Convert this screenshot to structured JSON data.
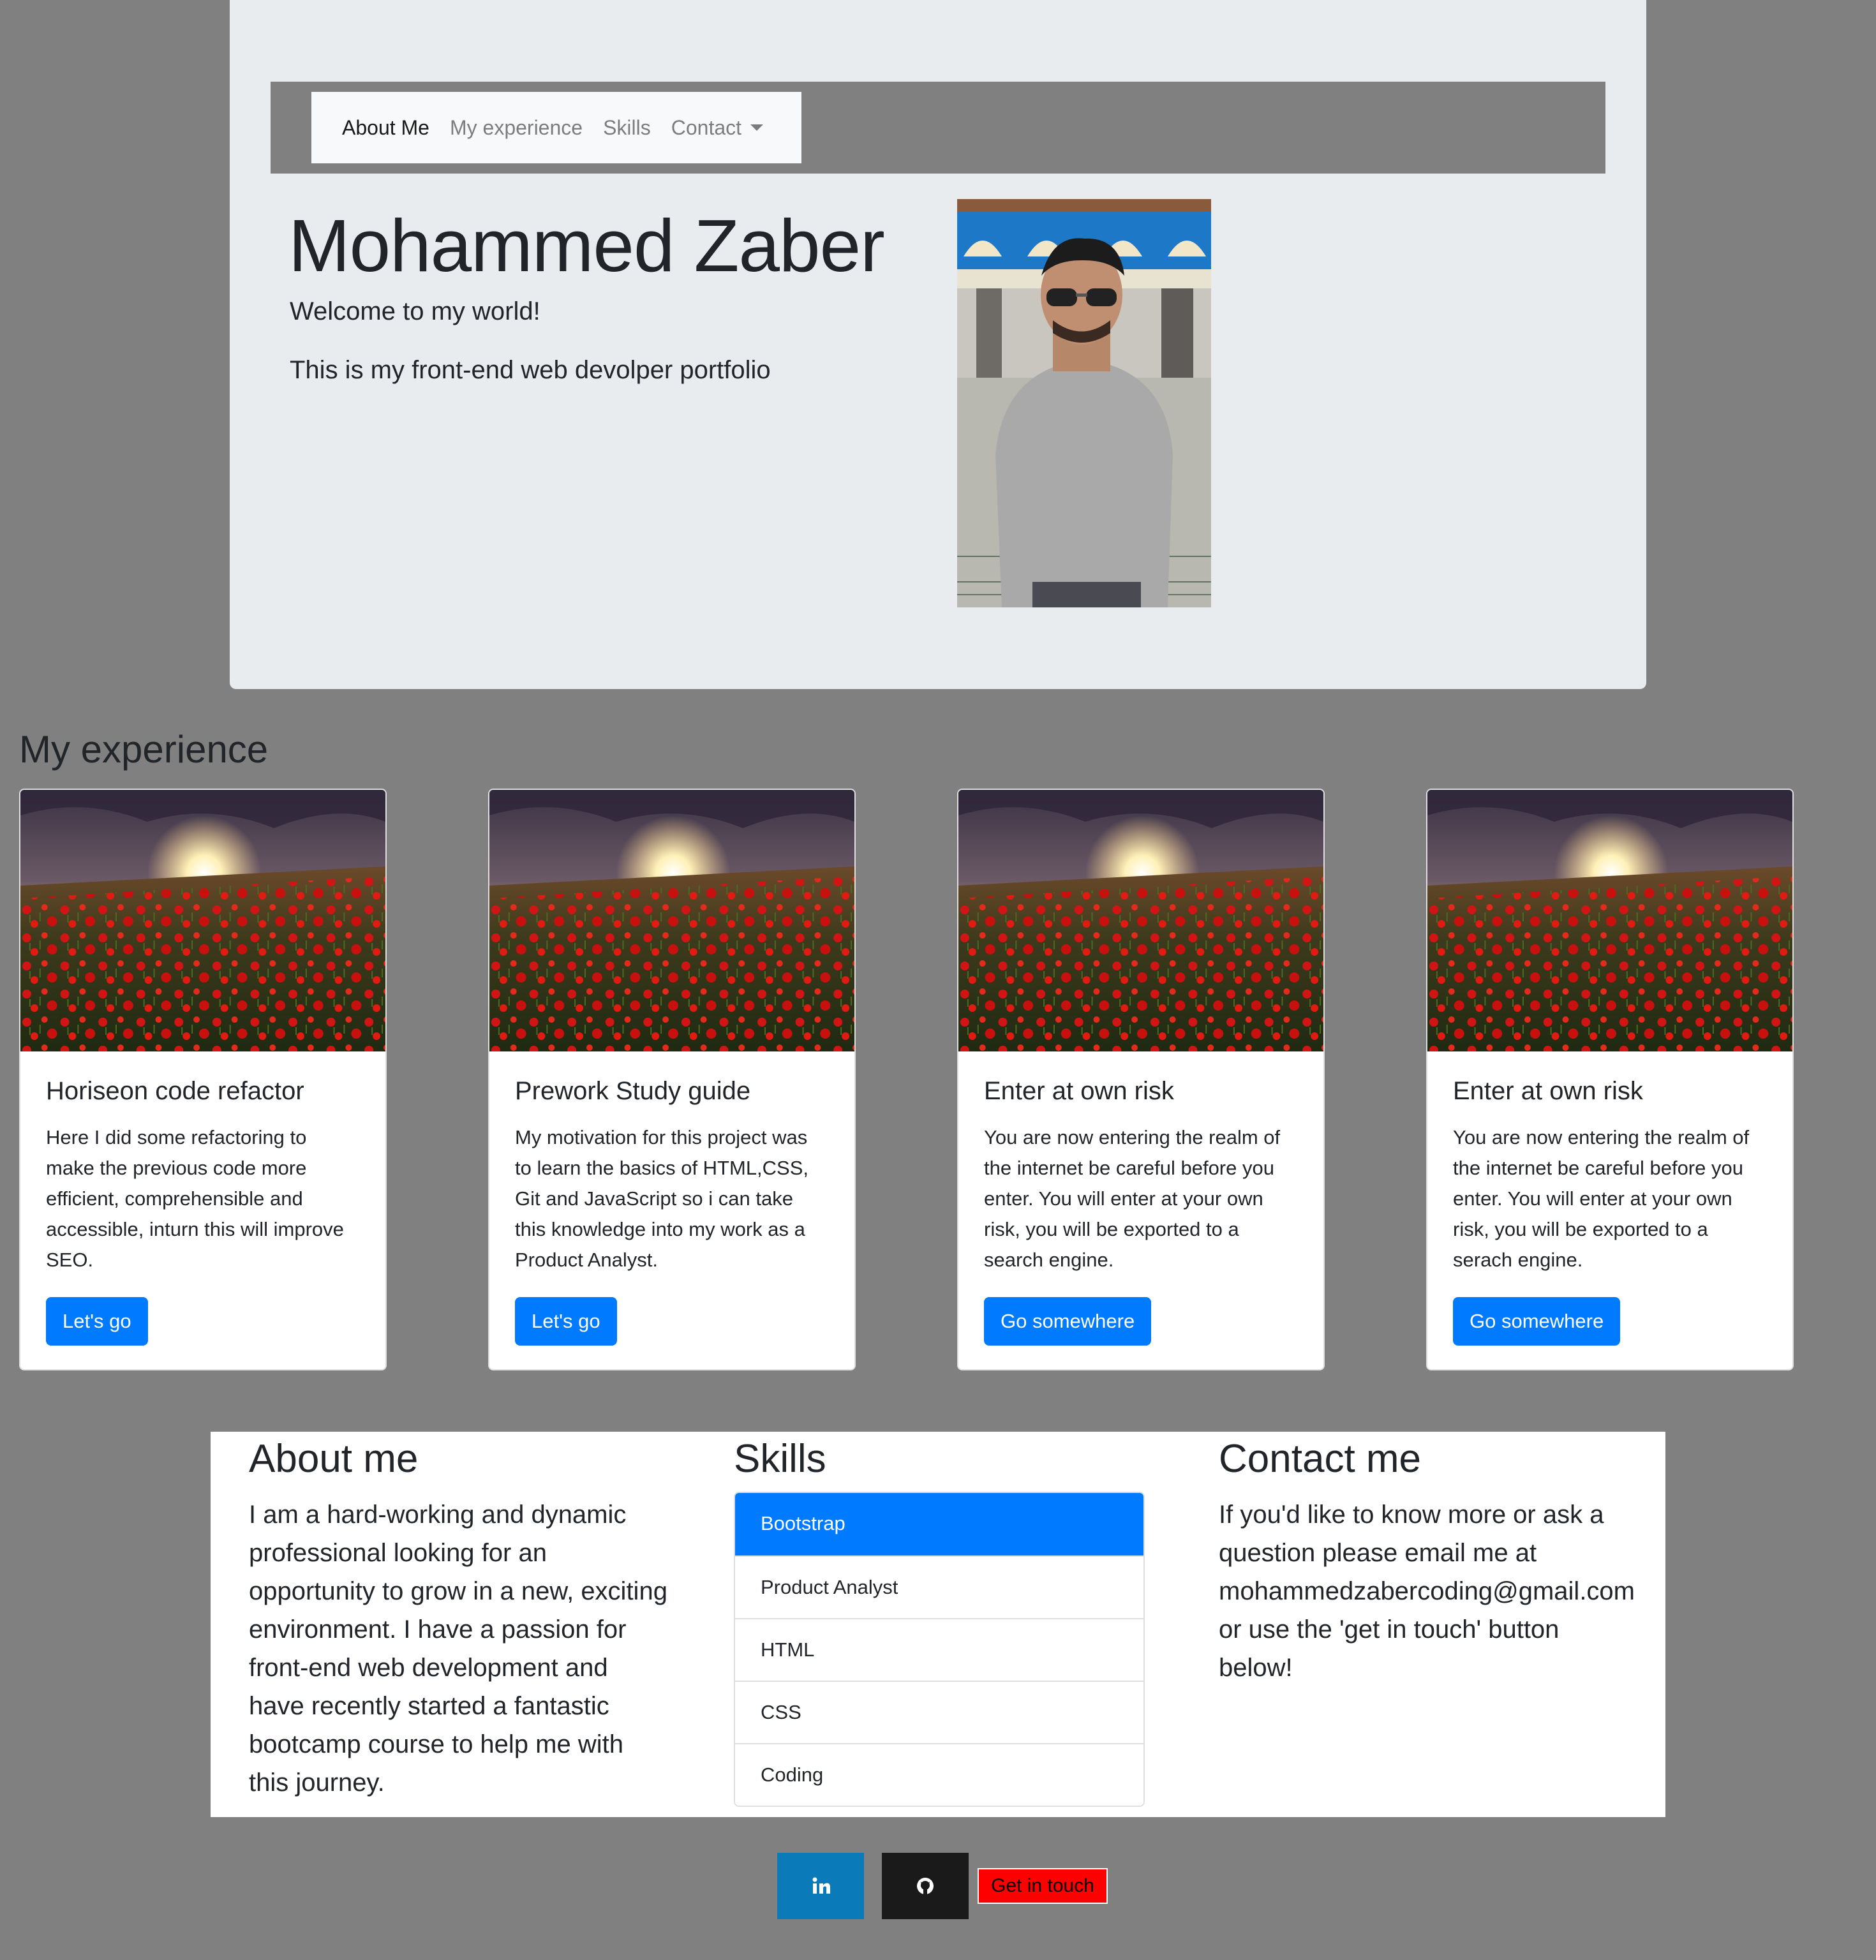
{
  "nav": {
    "items": [
      {
        "label": "About Me"
      },
      {
        "label": "My experience"
      },
      {
        "label": "Skills"
      },
      {
        "label": "Contact"
      }
    ]
  },
  "hero": {
    "title": "Mohammed Zaber",
    "lead1": "Welcome to my world!",
    "lead2": "This is my front-end web devolper portfolio"
  },
  "experience": {
    "title": "My experience",
    "cards": [
      {
        "title": "Horiseon code refactor",
        "text": "Here I did some refactoring to make the previous code more efficient, comprehensible and accessible, inturn this will improve SEO.",
        "button": "Let's go"
      },
      {
        "title": "Prework Study guide",
        "text": "My motivation for this project was to learn the basics of HTML,CSS, Git and JavaScript so i can take this knowledge into my work as a Product Analyst.",
        "button": "Let's go"
      },
      {
        "title": "Enter at own risk",
        "text": "You are now entering the realm of the internet be careful before you enter. You will enter at your own risk, you will be exported to a search engine.",
        "button": "Go somewhere"
      },
      {
        "title": "Enter at own risk",
        "text": "You are now entering the realm of the internet be careful before you enter. You will enter at your own risk, you will be exported to a serach engine.",
        "button": "Go somewhere"
      }
    ]
  },
  "about": {
    "title": "About me",
    "text": "I am a hard-working and dynamic professional looking for an opportunity to grow in a new, exciting environment. I have a passion for front-end web development and have recently started a fantastic bootcamp course to help me with this journey."
  },
  "skills": {
    "title": "Skills",
    "items": [
      {
        "label": "Bootstrap"
      },
      {
        "label": "Product Analyst"
      },
      {
        "label": "HTML"
      },
      {
        "label": "CSS"
      },
      {
        "label": "Coding"
      }
    ]
  },
  "contact": {
    "title": "Contact me",
    "text": "If you'd like to know more or ask a question please email me at mohammedzabercoding@gmail.com or use the 'get in touch' button below!"
  },
  "footer": {
    "linkedin_icon": "linkedin-icon",
    "github_icon": "github-icon",
    "contact_button": "Get in touch"
  },
  "colors": {
    "page_bg": "#808080",
    "jumbotron_bg": "#e9ecef",
    "primary": "#007bff",
    "linkedin": "#0a7ab8",
    "github": "#1a1a1a",
    "contact_button": "#ff0000"
  }
}
